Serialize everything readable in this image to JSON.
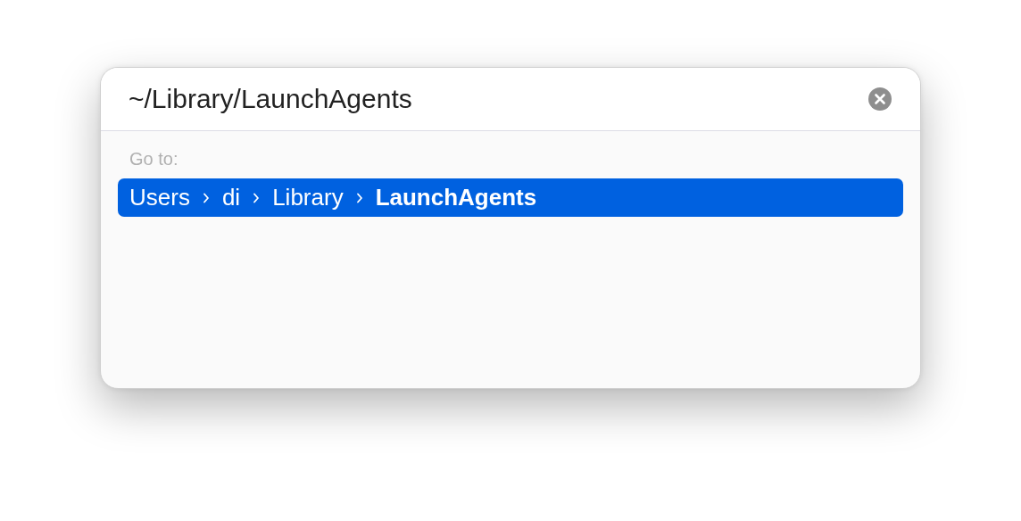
{
  "path_field": {
    "value": "~/Library/LaunchAgents"
  },
  "section_label": "Go to:",
  "results": [
    {
      "selected": true,
      "segments": [
        "Users",
        "di",
        "Library",
        "LaunchAgents"
      ]
    }
  ]
}
